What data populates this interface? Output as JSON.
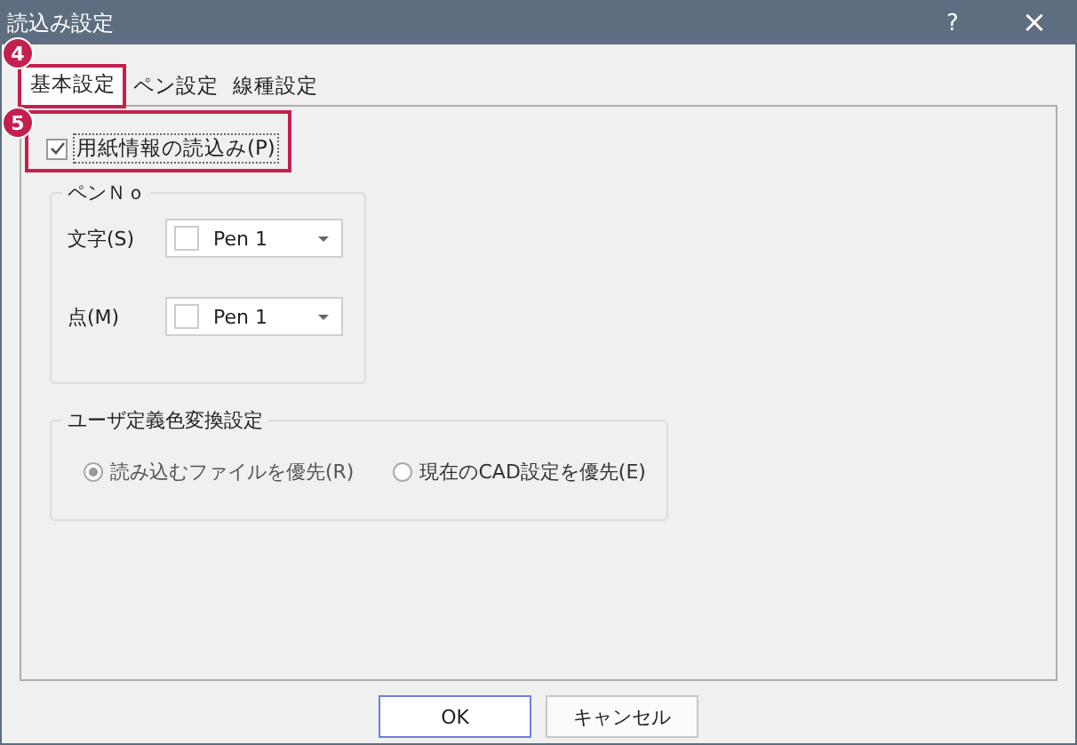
{
  "window": {
    "title": "読込み設定",
    "help": "?",
    "close": "×"
  },
  "tabs": [
    {
      "label": "基本設定",
      "selected": true
    },
    {
      "label": "ペン設定",
      "selected": false
    },
    {
      "label": "線種設定",
      "selected": false
    }
  ],
  "paper_checkbox": {
    "label": "用紙情報の読込み(P)",
    "checked": true
  },
  "pen_group": {
    "title": "ペンＮｏ",
    "fields": [
      {
        "label": "文字(S)",
        "value": "Pen 1"
      },
      {
        "label": "点(M)",
        "value": "Pen 1"
      }
    ]
  },
  "color_group": {
    "title": "ユーザ定義色変換設定",
    "options": [
      {
        "label": "読み込むファイルを優先(R)",
        "selected": true
      },
      {
        "label": "現在のCAD設定を優先(E)",
        "selected": false
      }
    ]
  },
  "buttons": [
    {
      "label": "OK",
      "default": true
    },
    {
      "label": "キャンセル",
      "default": false
    }
  ],
  "callouts": [
    {
      "number": "4"
    },
    {
      "number": "5"
    }
  ]
}
